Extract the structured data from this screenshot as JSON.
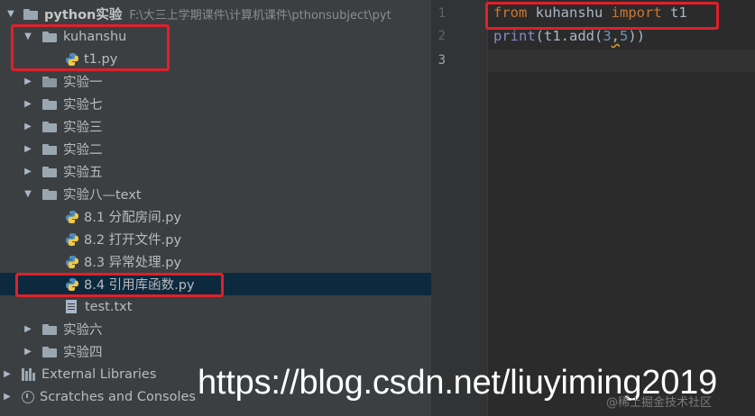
{
  "project": {
    "root_name": "python实验",
    "root_path": "F:\\大三上学期课件\\计算机课件\\pthonsubject\\pyt",
    "items": [
      {
        "label": "kuhanshu"
      },
      {
        "label": "t1.py"
      },
      {
        "label": "实验一"
      },
      {
        "label": "实验七"
      },
      {
        "label": "实验三"
      },
      {
        "label": "实验二"
      },
      {
        "label": "实验五"
      },
      {
        "label": "实验八—text"
      },
      {
        "label": "8.1 分配房间.py"
      },
      {
        "label": "8.2 打开文件.py"
      },
      {
        "label": "8.3 异常处理.py"
      },
      {
        "label": "8.4 引用库函数.py"
      },
      {
        "label": "test.txt"
      },
      {
        "label": "实验六"
      },
      {
        "label": "实验四"
      },
      {
        "label": "External Libraries"
      },
      {
        "label": "Scratches and Consoles"
      }
    ]
  },
  "editor": {
    "line_numbers": [
      "1",
      "2",
      "3"
    ],
    "line1": {
      "kw1": "from",
      "module": " kuhanshu ",
      "kw2": "import",
      "name": " t1"
    },
    "line2": {
      "fn": "print",
      "pre": "(t1.add(",
      "num1": "3",
      "comma": ",",
      "num2": "5",
      "post": "))"
    }
  },
  "watermark": {
    "url": "https://blog.csdn.net/liuyiming2019",
    "small": "@稀土掘金技术社区"
  },
  "colors": {
    "highlight_box": "#e0202a",
    "keyword": "#cc7832",
    "builtin": "#8888c6",
    "number": "#6897bb",
    "selection": "#0d293e"
  }
}
